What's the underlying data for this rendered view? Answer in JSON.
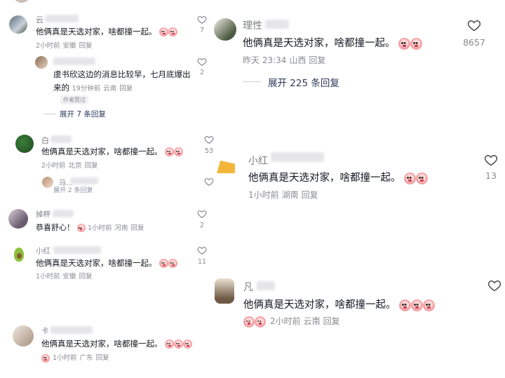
{
  "left": {
    "comments": [
      {
        "name": "云",
        "text": "他俩真是天选对家，啥都撞一起。",
        "emoji_count": 2,
        "time": "2小时前",
        "region": "安徽",
        "reply": "回复",
        "likes": "7"
      },
      {
        "name": "",
        "text_line1": "虞书欣这边的消息比较早，七月底爆出",
        "text_line2": "来的",
        "time": "19分钟前",
        "region": "云南",
        "reply": "回复",
        "likes": "2",
        "tag": "作者赞过"
      },
      {
        "name": "白",
        "text": "他俩真是天选对家，啥都撞一起。",
        "emoji_count": 2,
        "time": "2小时前",
        "region": "北京",
        "reply": "回复",
        "likes": "53"
      },
      {
        "name": "马...",
        "partial": "展开 2 条回复",
        "likes": ""
      },
      {
        "name": "掉秤",
        "text": "恭喜舒心！",
        "emoji_count": 1,
        "time": "1小时前",
        "region": "河南",
        "reply": "回复",
        "likes": "2"
      },
      {
        "name": "小红",
        "text": "他俩真是天选对家，啥都撞一起。",
        "emoji_count": 2,
        "time": "1小时前",
        "region": "安徽",
        "reply": "回复",
        "likes": "11"
      },
      {
        "name": "卡",
        "text": "他俩真是天选对家，啥都撞一起。",
        "emoji_count": 3,
        "lead_emoji": 1,
        "time": "1小时前",
        "region": "广东",
        "reply": "回复",
        "likes": ""
      }
    ],
    "expand_replies": "展开 7 条回复"
  },
  "right": {
    "comments": [
      {
        "name": "理性",
        "text": "他俩真是天选对家，啥都撞一起。",
        "emoji_count": 2,
        "time": "昨天 23:34",
        "region": "山西",
        "reply": "回复",
        "likes": "8657"
      },
      {
        "name": "小红",
        "text": "他俩真是天选对家，啥都撞一起。",
        "emoji_count": 2,
        "time": "1小时前",
        "region": "湖南",
        "reply": "回复",
        "likes": "13"
      },
      {
        "name": "凡",
        "text": "他俩真是天选对家，啥都撞一起。",
        "emoji_count": 3,
        "lead_emoji": 2,
        "time": "2小时前",
        "region": "云南",
        "reply": "回复",
        "likes": ""
      }
    ],
    "expand_replies": "展开 225 条回复"
  },
  "icons": {
    "heart": "heart-outline-icon",
    "emoji": "crying-face-emoji-icon"
  },
  "colors": {
    "text": "#161823",
    "meta": "#8a8b91",
    "expand": "#2b3a5a"
  }
}
